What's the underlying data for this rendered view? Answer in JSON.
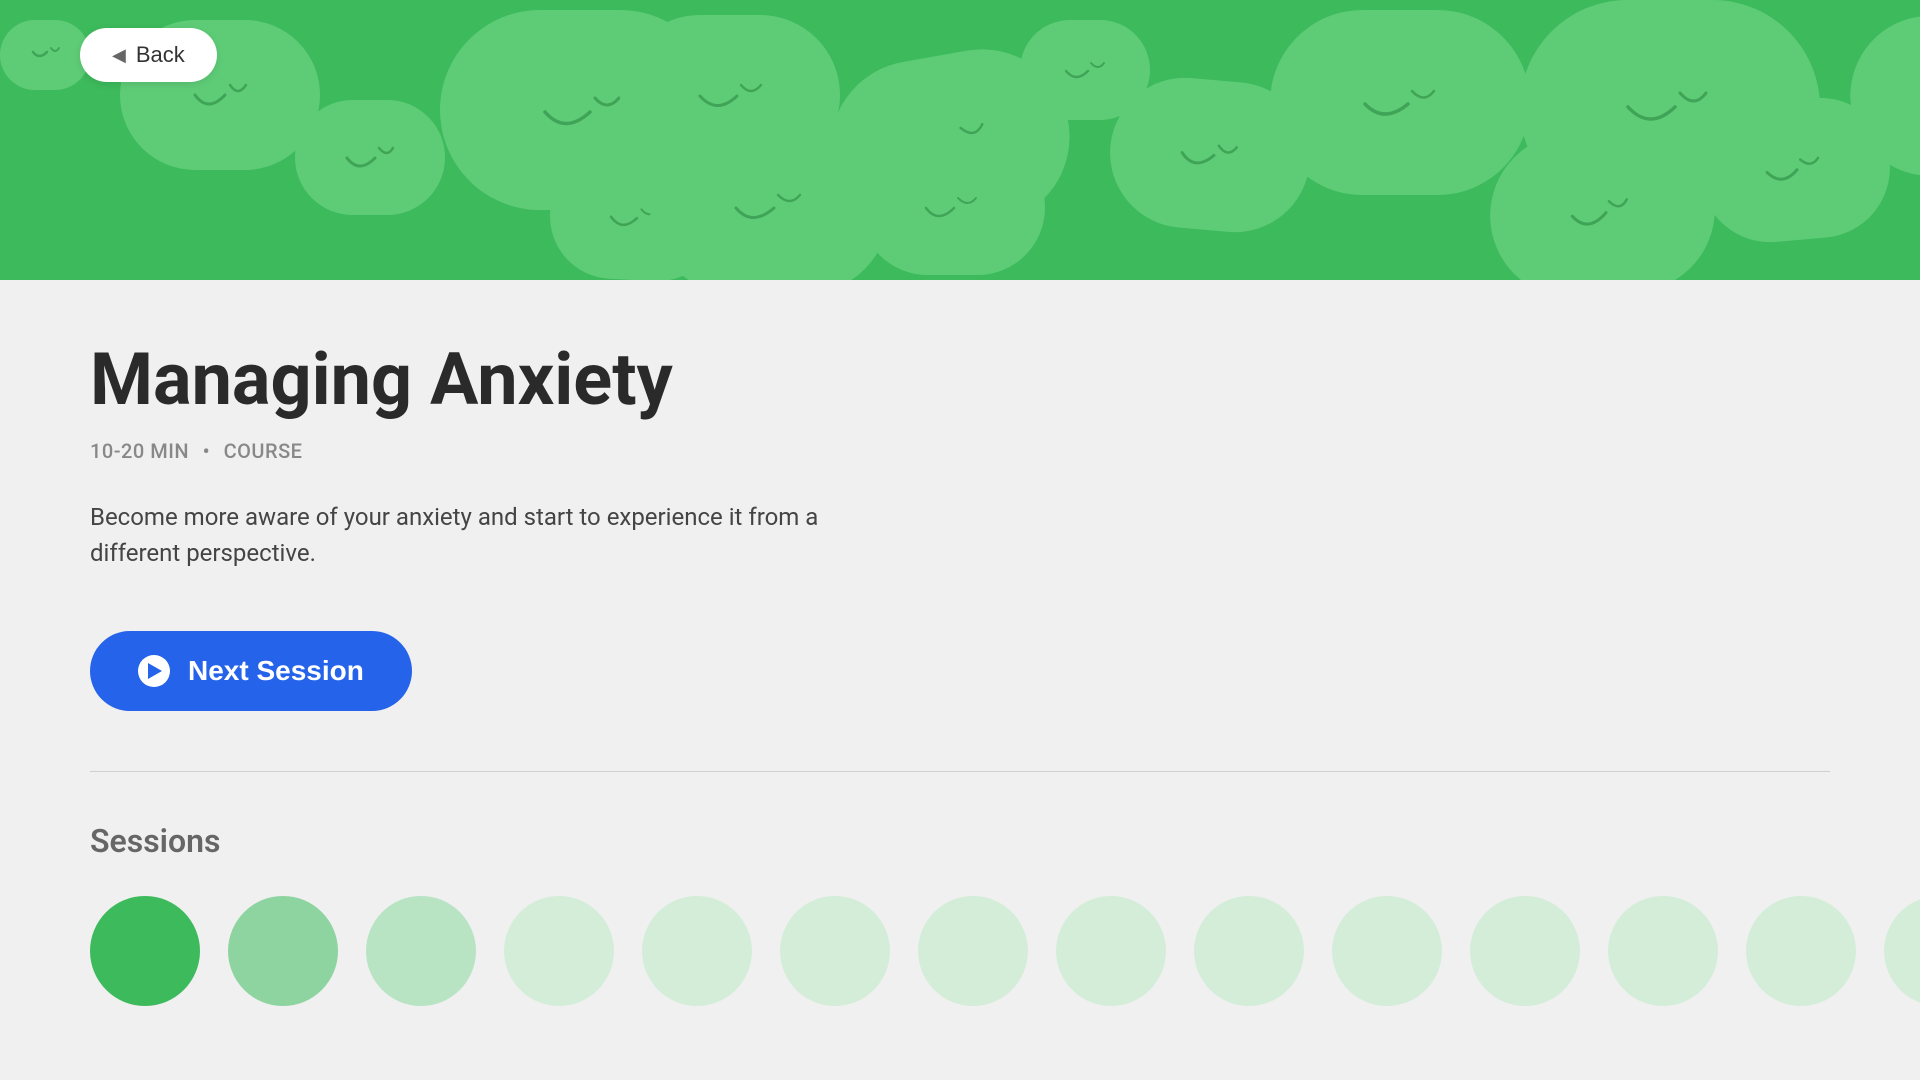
{
  "hero": {
    "background_color": "#3dba5c",
    "blob_color": "#5ecc77"
  },
  "back_button": {
    "label": "Back"
  },
  "course": {
    "title": "Managing Anxiety",
    "duration": "10-20 MIN",
    "type": "COURSE",
    "description": "Become more aware of your anxiety and start to experience it from a different perspective."
  },
  "next_session_button": {
    "label": "Next Session"
  },
  "sessions_section": {
    "label": "Sessions"
  }
}
